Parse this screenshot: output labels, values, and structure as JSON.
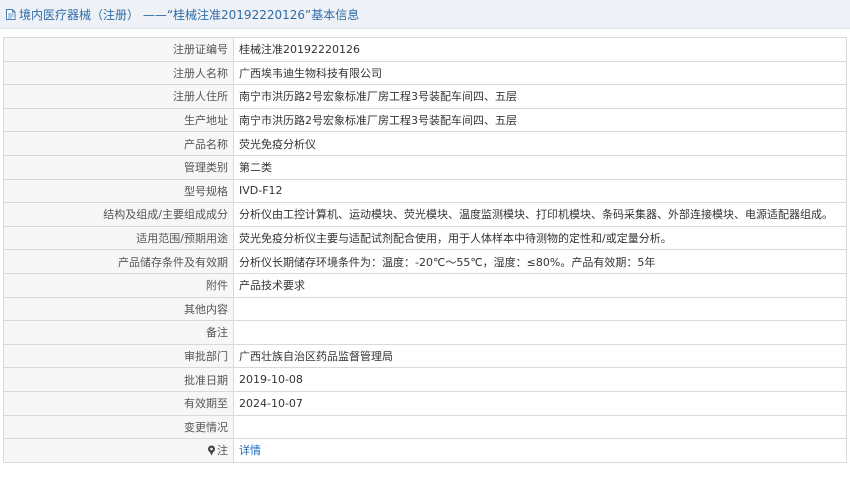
{
  "header": {
    "title": "境内医疗器械（注册） ——“桂械注准20192220126”基本信息"
  },
  "rows": [
    {
      "label": "注册证编号",
      "value": "桂械注准20192220126"
    },
    {
      "label": "注册人名称",
      "value": "广西埃韦迪生物科技有限公司"
    },
    {
      "label": "注册人住所",
      "value": "南宁市洪历路2号宏象标准厂房工程3号装配车间四、五层"
    },
    {
      "label": "生产地址",
      "value": "南宁市洪历路2号宏象标准厂房工程3号装配车间四、五层"
    },
    {
      "label": "产品名称",
      "value": "荧光免疫分析仪"
    },
    {
      "label": "管理类别",
      "value": "第二类"
    },
    {
      "label": "型号规格",
      "value": "IVD-F12"
    },
    {
      "label": "结构及组成/主要组成成分",
      "value": "分析仪由工控计算机、运动模块、荧光模块、温度监测模块、打印机模块、条码采集器、外部连接模块、电源适配器组成。"
    },
    {
      "label": "适用范围/预期用途",
      "value": "荧光免疫分析仪主要与适配试剂配合使用，用于人体样本中待测物的定性和/或定量分析。"
    },
    {
      "label": "产品储存条件及有效期",
      "value": "分析仪长期储存环境条件为：温度：-20℃～55℃，湿度：≤80%。产品有效期：5年"
    },
    {
      "label": "附件",
      "value": "产品技术要求"
    },
    {
      "label": "其他内容",
      "value": ""
    },
    {
      "label": "备注",
      "value": ""
    },
    {
      "label": "审批部门",
      "value": "广西壮族自治区药品监督管理局"
    },
    {
      "label": "批准日期",
      "value": "2019-10-08"
    },
    {
      "label": "有效期至",
      "value": "2024-10-07"
    },
    {
      "label": "变更情况",
      "value": ""
    }
  ],
  "note_row": {
    "label": "注",
    "link": "详情"
  },
  "icons": {
    "header": "document-icon",
    "note": "pin-icon"
  }
}
